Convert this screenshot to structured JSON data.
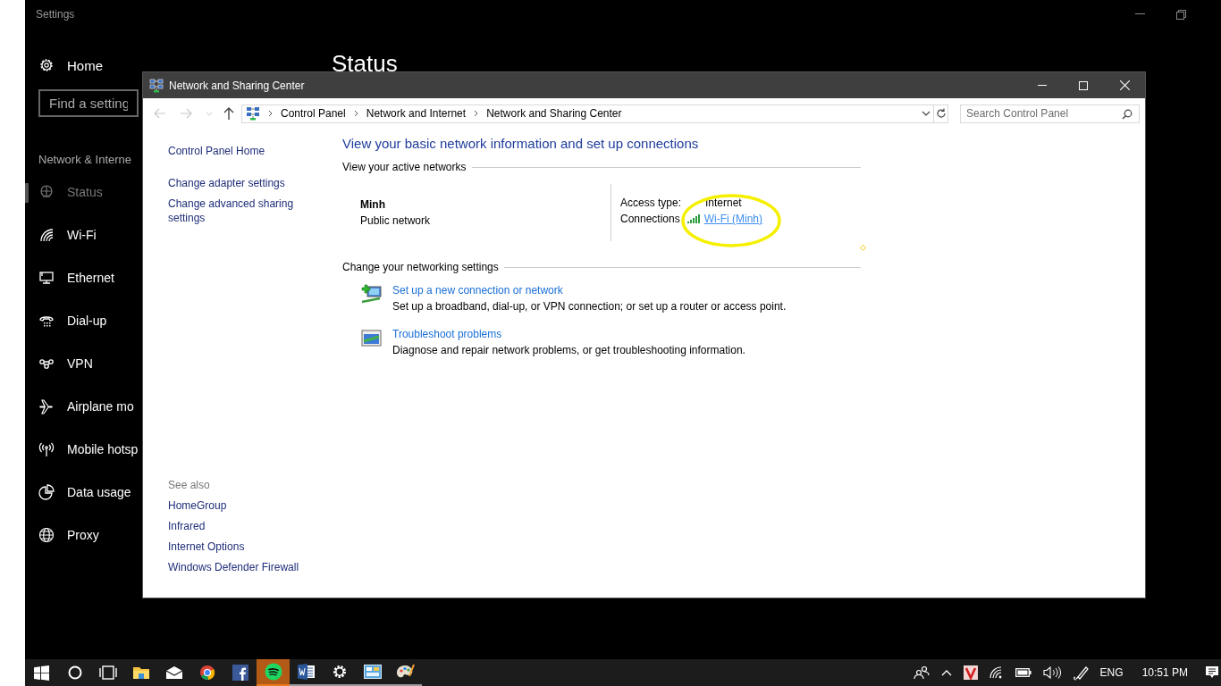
{
  "settings": {
    "title": "Settings",
    "home": "Home",
    "search": {
      "placeholder": "Find a setting"
    },
    "section": "Network & Interne",
    "page_title": "Status",
    "nav": [
      {
        "kind": "status",
        "label": "Status",
        "selected": true
      },
      {
        "kind": "wifi",
        "label": "Wi-Fi",
        "selected": false
      },
      {
        "kind": "ethernet",
        "label": "Ethernet",
        "selected": false
      },
      {
        "kind": "dialup",
        "label": "Dial-up",
        "selected": false
      },
      {
        "kind": "vpn",
        "label": "VPN",
        "selected": false
      },
      {
        "kind": "airplane",
        "label": "Airplane mo",
        "selected": false
      },
      {
        "kind": "hotspot",
        "label": "Mobile hotsp",
        "selected": false
      },
      {
        "kind": "data",
        "label": "Data usage",
        "selected": false
      },
      {
        "kind": "proxy",
        "label": "Proxy",
        "selected": false
      }
    ]
  },
  "window": {
    "title": "Network and Sharing Center",
    "breadcrumb": [
      "Control Panel",
      "Network and Internet",
      "Network and Sharing Center"
    ],
    "search": {
      "placeholder": "Search Control Panel"
    }
  },
  "tasks": [
    "Control Panel Home",
    "Change adapter settings",
    "Change advanced sharing settings"
  ],
  "see_also": {
    "heading": "See also",
    "links": [
      "HomeGroup",
      "Infrared",
      "Internet Options",
      "Windows Defender Firewall"
    ]
  },
  "main": {
    "heading": "View your basic network information and set up connections",
    "active_networks": {
      "title": "View your active networks",
      "name": "Minh",
      "category": "Public network",
      "access_label": "Access type:",
      "access_value": "Internet",
      "connections_label": "Connections",
      "connection": "Wi-Fi (Minh)"
    },
    "change_settings": {
      "title": "Change your networking settings",
      "items": [
        {
          "kind": "new-connection",
          "link": "Set up a new connection or network",
          "description": "Set up a broadband, dial-up, or VPN connection; or set up a router or access point."
        },
        {
          "kind": "troubleshoot",
          "link": "Troubleshoot problems",
          "description": "Diagnose and repair network problems, or get troubleshooting information."
        }
      ]
    }
  },
  "highlight": {
    "kind": "ellipse"
  },
  "taskbar": {
    "apps": [
      {
        "kind": "start",
        "running": false,
        "selected": false
      },
      {
        "kind": "cortana",
        "running": false,
        "selected": false
      },
      {
        "kind": "taskview",
        "running": false,
        "selected": false
      },
      {
        "kind": "explorer",
        "running": false,
        "selected": false
      },
      {
        "kind": "mail",
        "running": false,
        "selected": false
      },
      {
        "kind": "chrome",
        "running": false,
        "selected": false
      },
      {
        "kind": "facebook",
        "running": false,
        "selected": false
      },
      {
        "kind": "spotify",
        "running": true,
        "selected": true
      },
      {
        "kind": "word",
        "running": true,
        "selected": false
      },
      {
        "kind": "settings",
        "running": true,
        "selected": false
      },
      {
        "kind": "controlpanel",
        "running": true,
        "selected": false
      },
      {
        "kind": "paint",
        "running": true,
        "selected": false
      }
    ],
    "language": "ENG",
    "time": "10:51 PM"
  }
}
